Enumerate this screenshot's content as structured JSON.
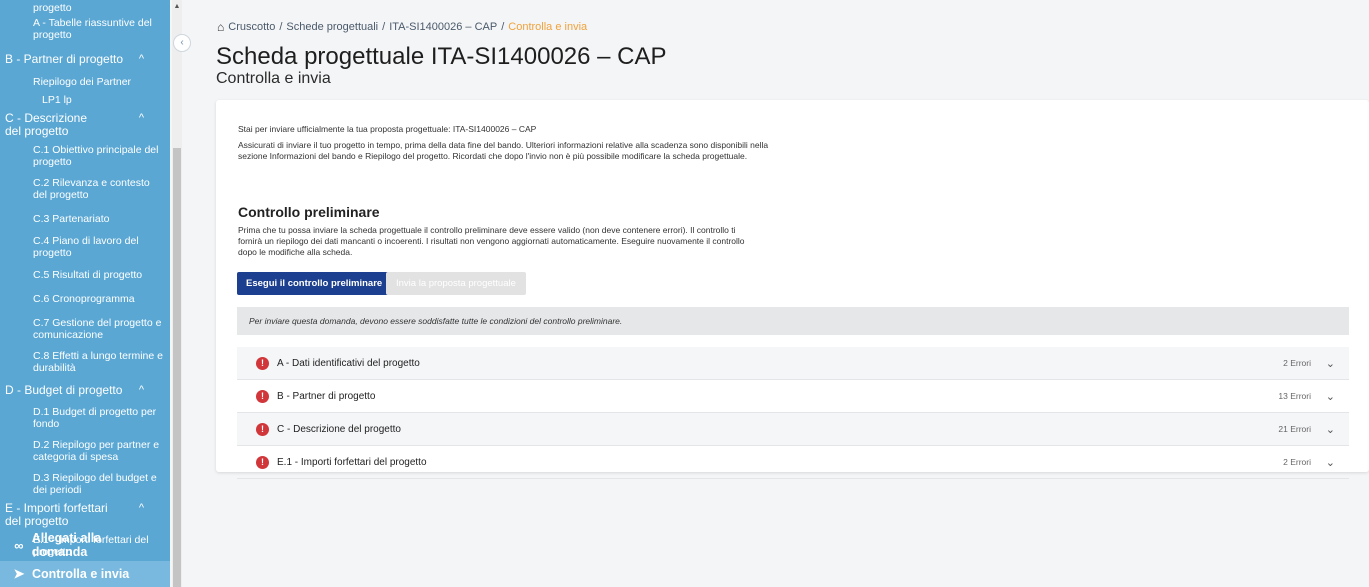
{
  "sidebar": {
    "items": [
      {
        "text": "progetto",
        "kind": "item"
      },
      {
        "text": "A - Tabelle riassuntive del progetto",
        "kind": "item"
      },
      {
        "text": "B - Partner di progetto",
        "kind": "section"
      },
      {
        "text": "Riepilogo dei Partner",
        "kind": "item"
      },
      {
        "text": "LP1 lp",
        "kind": "item"
      },
      {
        "text": "C - Descrizione del progetto",
        "kind": "section"
      },
      {
        "text": "C.1 Obiettivo principale del progetto",
        "kind": "item"
      },
      {
        "text": "C.2 Rilevanza e contesto del progetto",
        "kind": "item"
      },
      {
        "text": "C.3 Partenariato",
        "kind": "item"
      },
      {
        "text": "C.4 Piano di lavoro del progetto",
        "kind": "item"
      },
      {
        "text": "C.5 Risultati di progetto",
        "kind": "item"
      },
      {
        "text": "C.6 Cronoprogramma",
        "kind": "item"
      },
      {
        "text": "C.7 Gestione del progetto e comunicazione",
        "kind": "item"
      },
      {
        "text": "C.8 Effetti a lungo termine e durabilità",
        "kind": "item"
      },
      {
        "text": "D - Budget di progetto",
        "kind": "section"
      },
      {
        "text": "D.1 Budget di progetto per fondo",
        "kind": "item"
      },
      {
        "text": "D.2 Riepilogo per partner e categoria di spesa",
        "kind": "item"
      },
      {
        "text": "D.3 Riepilogo del budget e dei periodi",
        "kind": "item"
      },
      {
        "text": "E - Importi forfettari del progetto",
        "kind": "section"
      },
      {
        "text": "E.1 - Importi forfettari del progetto",
        "kind": "item"
      }
    ],
    "allegati": "Allegati alla domanda",
    "controlla": "Controlla e invia",
    "caret": "^"
  },
  "breadcrumb": {
    "home": "Cruscotto",
    "sep": "/",
    "schede": "Schede progettuali",
    "scheda": "ITA-SI1400026 – CAP",
    "current": "Controlla e invia"
  },
  "header": {
    "title": "Scheda progettuale ITA-SI1400026 – CAP",
    "subtitle": "Controlla e invia"
  },
  "content": {
    "intro": "Stai per inviare ufficialmente la tua proposta progettuale: ITA-SI1400026 – CAP",
    "intro2": "Assicurati di inviare il tuo progetto in tempo, prima della data fine del bando. Ulteriori informazioni relative alla scadenza sono disponibili nella sezione Informazioni del bando e Riepilogo del progetto. Ricordati che dopo l'invio non è più possibile modificare la scheda progettuale.",
    "heading": "Controllo preliminare",
    "desc": "Prima che tu possa inviare la scheda progettuale il controllo preliminare deve essere valido (non deve contenere errori). Il controllo ti fornirà un riepilogo dei dati mancanti o incoerenti. I risultati non vengono aggiornati automaticamente. Eseguire nuovamente il controllo dopo le modifiche alla scheda.",
    "btn_check": "Esegui il controllo preliminare",
    "btn_submit": "Invia la proposta progettuale",
    "notice": "Per inviare questa domanda, devono essere soddisfatte tutte le condizioni del controllo preliminare.",
    "accordions": [
      {
        "title": "A - Dati identificativi del progetto",
        "count": "2 Errori"
      },
      {
        "title": "B - Partner di progetto",
        "count": "13 Errori"
      },
      {
        "title": "C - Descrizione del progetto",
        "count": "21 Errori"
      },
      {
        "title": "E.1 - Importi forfettari del progetto",
        "count": "2 Errori"
      }
    ]
  },
  "icons": {
    "home": "home-icon",
    "error": "error-icon",
    "chevron": "chevron-down-icon",
    "attachment": "attachment-icon",
    "send": "send-icon",
    "collapse": "chevron-left-icon"
  },
  "colors": {
    "sidebar": "#5aa7d4",
    "primary": "#1d3f8f",
    "accent": "#f0a23a",
    "error": "#d0363a"
  }
}
